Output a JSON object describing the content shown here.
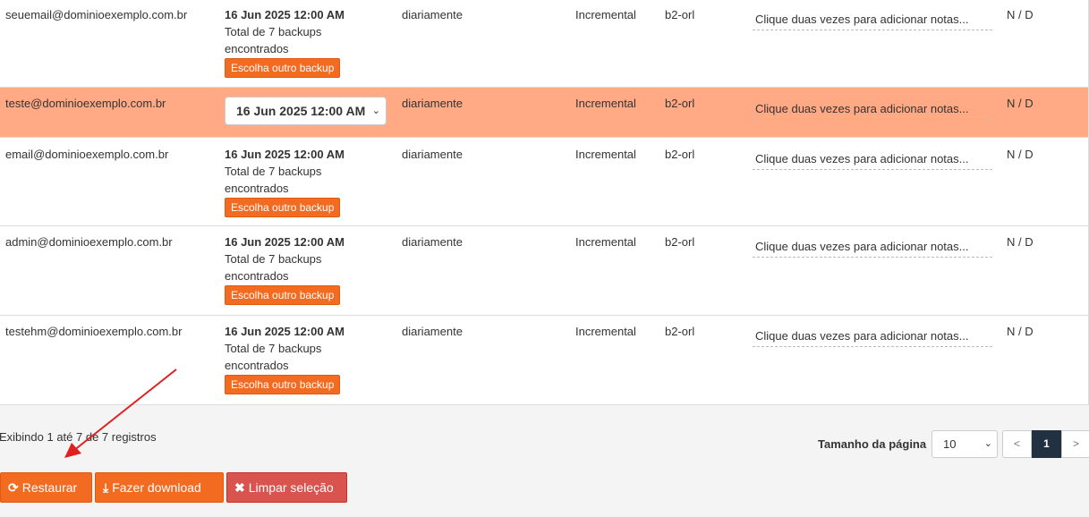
{
  "rows": [
    {
      "email": "seuemail@dominioexemplo.com.br",
      "date": "16 Jun 2025 12:00 AM",
      "backups_text": "Total de 7 backups encontrados",
      "choose_label": "Escolha outro backup",
      "frequency": "diariamente",
      "type": "Incremental",
      "location": "b2-orl",
      "notes": "Clique duas vezes para adicionar notas...",
      "nd": "N / D"
    },
    {
      "email": "teste@dominioexemplo.com.br",
      "date": "16 Jun 2025 12:00 AM",
      "frequency": "diariamente",
      "type": "Incremental",
      "location": "b2-orl",
      "notes": "Clique duas vezes para adicionar notas...",
      "nd": "N / D"
    },
    {
      "email": "email@dominioexemplo.com.br",
      "date": "16 Jun 2025 12:00 AM",
      "backups_text": "Total de 7 backups encontrados",
      "choose_label": "Escolha outro backup",
      "frequency": "diariamente",
      "type": "Incremental",
      "location": "b2-orl",
      "notes": "Clique duas vezes para adicionar notas...",
      "nd": "N / D"
    },
    {
      "email": "admin@dominioexemplo.com.br",
      "date": "16 Jun 2025 12:00 AM",
      "backups_text": "Total de 7 backups encontrados",
      "choose_label": "Escolha outro backup",
      "frequency": "diariamente",
      "type": "Incremental",
      "location": "b2-orl",
      "notes": "Clique duas vezes para adicionar notas...",
      "nd": "N / D"
    },
    {
      "email": "testehm@dominioexemplo.com.br",
      "date": "16 Jun 2025 12:00 AM",
      "backups_text": "Total de 7 backups encontrados",
      "choose_label": "Escolha outro backup",
      "frequency": "diariamente",
      "type": "Incremental",
      "location": "b2-orl",
      "notes": "Clique duas vezes para adicionar notas...",
      "nd": "N / D"
    }
  ],
  "footer": {
    "info": "Exibindo 1 até 7 de 7 registros",
    "page_size_label": "Tamanho da página",
    "page_size_value": "10",
    "prev": "<",
    "current_page": "1",
    "next": ">"
  },
  "actions": {
    "restore": "Restaurar",
    "download": "Fazer download",
    "clear": "Limpar seleção"
  },
  "icons": {
    "restore": "refresh-icon",
    "download": "download-icon",
    "clear": "close-icon"
  },
  "colors": {
    "accent": "#f36b21",
    "selected_row": "#ffaa85",
    "danger": "#d9534f",
    "pager_active": "#213141",
    "annotation_arrow": "#e02020"
  }
}
